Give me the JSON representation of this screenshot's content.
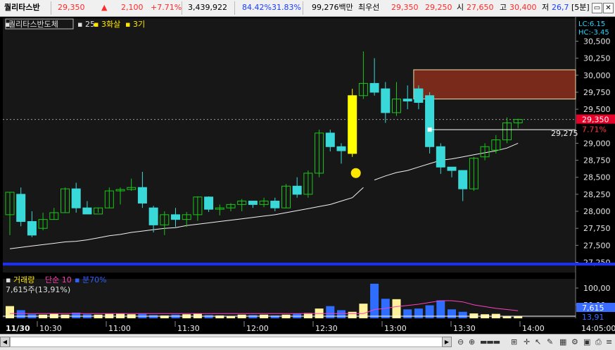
{
  "header": {
    "stock_name": "퀄리타스반",
    "price": "29,350",
    "change_arrow": "▲",
    "change": "2,100",
    "change_pct": "+7.71%",
    "volume": "3,439,922",
    "rate1": "84.42%",
    "rate2": "31.83%",
    "amount": "99,276백만",
    "best_label": "최우선",
    "ask": "29,350",
    "bid": "29,250",
    "open_label": "시",
    "open": "27,650",
    "high_label": "고",
    "high": "30,400",
    "low_label": "저",
    "low": "26,7",
    "period": "[5분]",
    "colors": {
      "up": "#ff2a2a",
      "down": "#1a3cff"
    }
  },
  "chart_header": {
    "name_box": "퀄리타스반도체",
    "ma_period": "25",
    "signal1": "3화살",
    "signal2": "3기"
  },
  "chart_data": {
    "type": "candlestick",
    "price_axis": [
      "30,500",
      "30,250",
      "30,000",
      "29,750",
      "29,500",
      "29,000",
      "28,750",
      "28,500",
      "28,250",
      "28,000",
      "27,750",
      "27,500",
      "27,250"
    ],
    "ylim": [
      27100,
      30650
    ],
    "lc_label": "LC:6.15",
    "hc_label": "HC:-3.45",
    "last_price": "29,350",
    "last_pct": "7.71%",
    "ma_label_value": "29,275",
    "candles": [
      {
        "o": 27950,
        "h": 28280,
        "l": 27650,
        "c": 28280
      },
      {
        "o": 28250,
        "h": 28350,
        "l": 27780,
        "c": 27850
      },
      {
        "o": 27850,
        "h": 28000,
        "l": 27620,
        "c": 27650
      },
      {
        "o": 27750,
        "h": 27980,
        "l": 27720,
        "c": 27880
      },
      {
        "o": 27880,
        "h": 28050,
        "l": 27880,
        "c": 27980
      },
      {
        "o": 27980,
        "h": 28350,
        "l": 27980,
        "c": 28330
      },
      {
        "o": 28330,
        "h": 28420,
        "l": 27980,
        "c": 28050
      },
      {
        "o": 28050,
        "h": 28150,
        "l": 27960,
        "c": 27960
      },
      {
        "o": 27960,
        "h": 28050,
        "l": 27980,
        "c": 28050
      },
      {
        "o": 28050,
        "h": 28350,
        "l": 28050,
        "c": 28300
      },
      {
        "o": 28300,
        "h": 28350,
        "l": 28100,
        "c": 28320
      },
      {
        "o": 28320,
        "h": 28480,
        "l": 28300,
        "c": 28350
      },
      {
        "o": 28350,
        "h": 28580,
        "l": 28050,
        "c": 28120
      },
      {
        "o": 28050,
        "h": 28080,
        "l": 27690,
        "c": 27800
      },
      {
        "o": 27800,
        "h": 28000,
        "l": 27650,
        "c": 27950
      },
      {
        "o": 27950,
        "h": 28050,
        "l": 27770,
        "c": 27880
      },
      {
        "o": 27880,
        "h": 27990,
        "l": 27770,
        "c": 27950
      },
      {
        "o": 27950,
        "h": 28220,
        "l": 27860,
        "c": 28210
      },
      {
        "o": 28210,
        "h": 28220,
        "l": 27990,
        "c": 28030
      },
      {
        "o": 28030,
        "h": 28100,
        "l": 27940,
        "c": 28050
      },
      {
        "o": 28050,
        "h": 28120,
        "l": 28000,
        "c": 28100
      },
      {
        "o": 28100,
        "h": 28180,
        "l": 28000,
        "c": 28150
      },
      {
        "o": 28150,
        "h": 28150,
        "l": 28050,
        "c": 28100
      },
      {
        "o": 28100,
        "h": 28200,
        "l": 28060,
        "c": 28150
      },
      {
        "o": 28150,
        "h": 28200,
        "l": 28000,
        "c": 28050
      },
      {
        "o": 28050,
        "h": 28400,
        "l": 28050,
        "c": 28370
      },
      {
        "o": 28370,
        "h": 28500,
        "l": 28200,
        "c": 28250
      },
      {
        "o": 28250,
        "h": 28600,
        "l": 28200,
        "c": 28560
      },
      {
        "o": 28560,
        "h": 29200,
        "l": 28500,
        "c": 29150
      },
      {
        "o": 29150,
        "h": 29200,
        "l": 28880,
        "c": 28950
      },
      {
        "o": 28950,
        "h": 29000,
        "l": 28700,
        "c": 28890
      },
      {
        "o": 28850,
        "h": 29800,
        "l": 28800,
        "c": 29700
      },
      {
        "o": 29700,
        "h": 30350,
        "l": 29650,
        "c": 29880
      },
      {
        "o": 29880,
        "h": 30250,
        "l": 29700,
        "c": 29750
      },
      {
        "o": 29800,
        "h": 29900,
        "l": 29300,
        "c": 29450
      },
      {
        "o": 29450,
        "h": 29900,
        "l": 29400,
        "c": 29650
      },
      {
        "o": 29650,
        "h": 29850,
        "l": 29500,
        "c": 29620
      },
      {
        "o": 29800,
        "h": 29850,
        "l": 29500,
        "c": 29600
      },
      {
        "o": 29700,
        "h": 29750,
        "l": 28850,
        "c": 28950
      },
      {
        "o": 28950,
        "h": 29000,
        "l": 28550,
        "c": 28650
      },
      {
        "o": 28650,
        "h": 28650,
        "l": 28500,
        "c": 28600
      },
      {
        "o": 28600,
        "h": 28600,
        "l": 28150,
        "c": 28330
      },
      {
        "o": 28330,
        "h": 28800,
        "l": 28300,
        "c": 28780
      },
      {
        "o": 28800,
        "h": 29000,
        "l": 28750,
        "c": 28950
      },
      {
        "o": 28900,
        "h": 29120,
        "l": 28850,
        "c": 29050
      },
      {
        "o": 29050,
        "h": 29380,
        "l": 29000,
        "c": 29300
      },
      {
        "o": 29300,
        "h": 29360,
        "l": 29220,
        "c": 29350
      }
    ],
    "ma_values": [
      27450,
      27470,
      27490,
      27510,
      27530,
      27550,
      27560,
      27580,
      27610,
      27640,
      27660,
      27690,
      27710,
      27730,
      27750,
      27760,
      27790,
      27810,
      27830,
      27850,
      27870,
      27890,
      27910,
      27930,
      27950,
      27980,
      28010,
      28040,
      28070,
      28100,
      28150,
      28200,
      28350,
      28460,
      28520,
      28570,
      28600,
      28650,
      28700,
      28750,
      28770,
      28800,
      28830,
      28860,
      28890,
      28930,
      29000
    ],
    "highlight_candle_index": 31,
    "signal_dot_index": 31,
    "zone": {
      "start_index": 37,
      "top": 30080,
      "bottom": 29650
    },
    "marker_index": 38,
    "volume_panel": {
      "title": "거래량",
      "ma_label": "단순 10",
      "extra_label": "분70%",
      "readout": "7,615주(13,91%)",
      "axis": [
        "100,00",
        "50,00"
      ],
      "badge1": "7,615",
      "badge2": "13,91",
      "volumes": [
        30,
        20,
        10,
        9,
        11,
        9,
        14,
        10,
        9,
        11,
        12,
        10,
        11,
        8,
        7,
        9,
        10,
        12,
        8,
        7,
        6,
        9,
        8,
        9,
        7,
        9,
        12,
        13,
        24,
        30,
        20,
        16,
        36,
        85,
        48,
        47,
        22,
        24,
        32,
        44,
        22,
        16,
        12,
        10,
        11,
        6,
        5
      ],
      "volume_ratio": [
        0.08,
        0.08,
        0.08,
        0.08,
        0.08,
        0.08,
        0.08,
        0.08,
        0.08,
        0.08,
        0.08,
        0.08,
        0.08,
        0.08,
        0.08,
        0.08,
        0.08,
        0.08,
        0.08,
        0.08,
        0.08,
        0.08,
        0.08,
        0.08,
        0.08,
        0.08,
        0.08,
        0.08,
        0.08,
        0.08,
        0.08,
        0.08,
        0.08,
        0.15,
        0.17,
        0.2,
        0.22,
        0.24,
        0.27,
        0.3,
        0.3,
        0.28,
        0.23,
        0.2,
        0.17,
        0.15,
        0.13
      ]
    },
    "time_axis": [
      "11/30",
      "10:30",
      "11:00",
      "11:30",
      "12:00",
      "12:30",
      "13:00",
      "13:30",
      "14:00",
      "14:05:00"
    ]
  }
}
